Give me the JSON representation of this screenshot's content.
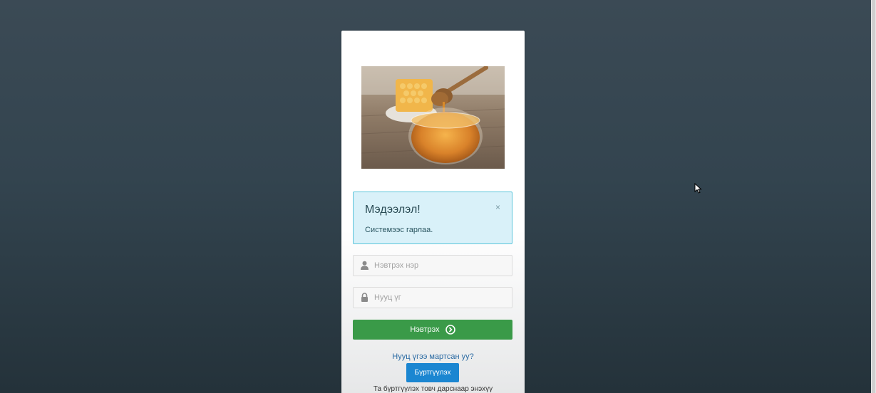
{
  "alert": {
    "title": "Мэдээлэл!",
    "close": "×",
    "message": "Системээс гарлаа."
  },
  "form": {
    "username_placeholder": "Нэвтрэх нэр",
    "password_placeholder": "Нууц үг",
    "login_label": "Нэвтрэх",
    "forgot_label": "Нууц үгээ мартсан уу?",
    "register_label": "Бүртгүүлэх",
    "register_note": "Та бүртгүүлэх товч дарснаар энэхүү"
  },
  "icons": {
    "username": "user-icon",
    "password": "lock-icon",
    "login": "arrow-circle-right-icon",
    "close": "close-icon"
  },
  "colors": {
    "alert_bg": "#d9f1f9",
    "alert_border": "#5bc5db",
    "login_button": "#3a9a48",
    "register_button": "#1b86d1",
    "link": "#2a6aa3"
  }
}
